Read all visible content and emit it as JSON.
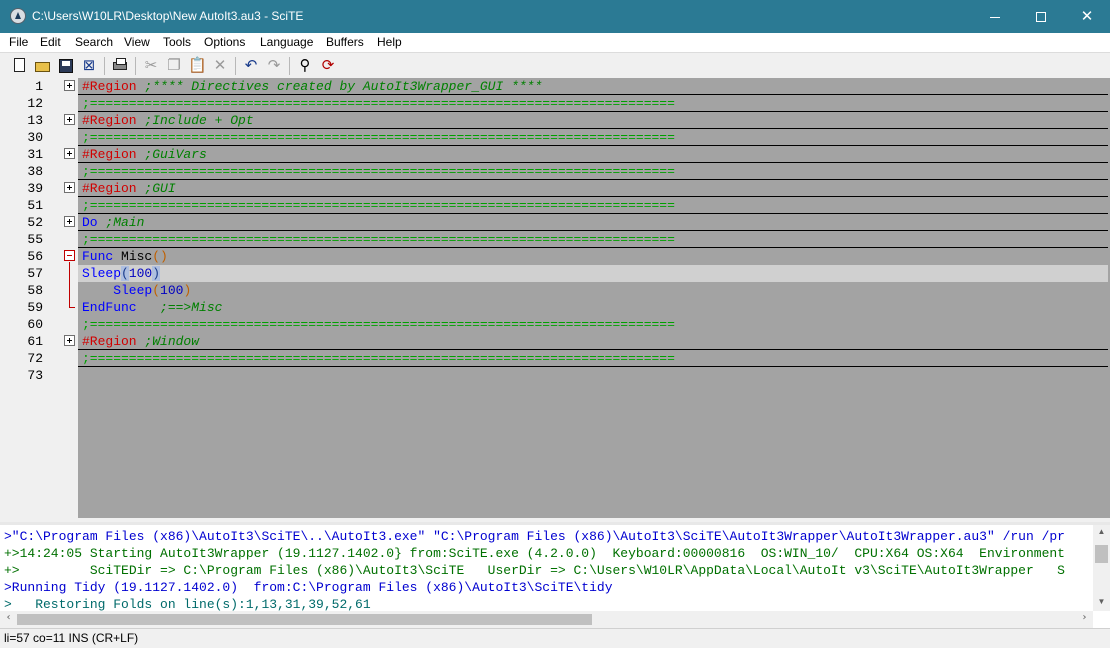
{
  "window": {
    "title": "C:\\Users\\W10LR\\Desktop\\New AutoIt3.au3 - SciTE",
    "app_icon": "scite-app-icon",
    "minimize_icon": "minimize-icon",
    "maximize_icon": "maximize-icon",
    "close_icon": "close-icon",
    "close_glyph": "✕"
  },
  "menu": [
    "File",
    "Edit",
    "Search",
    "View",
    "Tools",
    "Options",
    "Language",
    "Buffers",
    "Help"
  ],
  "toolbar": {
    "icons": [
      "new-file-icon",
      "open-folder-icon",
      "save-icon",
      "close-file-icon",
      "print-icon",
      "cut-icon",
      "copy-icon",
      "paste-icon",
      "delete-icon",
      "undo-icon",
      "redo-icon",
      "find-icon",
      "replace-icon"
    ],
    "glyphs": {
      "close": "⊠",
      "cut": "✂",
      "copy": "❐",
      "paste": "📋",
      "delete": "✕",
      "undo": "↶",
      "redo": "↷",
      "find": "⚲",
      "replace": "⟳"
    }
  },
  "editor": {
    "lines": [
      {
        "num": "1",
        "fold": "plus",
        "tokens": [
          {
            "t": "#Region",
            "c": "region"
          },
          {
            "t": " ;**** Directives created by AutoIt3Wrapper_GUI ****",
            "c": "comment"
          }
        ]
      },
      {
        "num": "12",
        "fold": "line",
        "tokens": [
          {
            "t": ";===========================================================================",
            "c": "sep"
          }
        ]
      },
      {
        "num": "13",
        "fold": "plus",
        "tokens": [
          {
            "t": "#Region",
            "c": "region"
          },
          {
            "t": " ;Include + Opt",
            "c": "comment"
          }
        ]
      },
      {
        "num": "30",
        "fold": "line",
        "tokens": [
          {
            "t": ";===========================================================================",
            "c": "sep"
          }
        ]
      },
      {
        "num": "31",
        "fold": "plus",
        "tokens": [
          {
            "t": "#Region",
            "c": "region"
          },
          {
            "t": " ;GuiVars",
            "c": "comment"
          }
        ]
      },
      {
        "num": "38",
        "fold": "line",
        "tokens": [
          {
            "t": ";===========================================================================",
            "c": "sep"
          }
        ]
      },
      {
        "num": "39",
        "fold": "plus",
        "tokens": [
          {
            "t": "#Region",
            "c": "region"
          },
          {
            "t": " ;GUI",
            "c": "comment"
          }
        ]
      },
      {
        "num": "51",
        "fold": "line",
        "tokens": [
          {
            "t": ";===========================================================================",
            "c": "sep"
          }
        ]
      },
      {
        "num": "52",
        "fold": "plus",
        "tokens": [
          {
            "t": "Do",
            "c": "kw"
          },
          {
            "t": " ;Main",
            "c": "comment"
          }
        ]
      },
      {
        "num": "55",
        "fold": "line",
        "tokens": [
          {
            "t": ";===========================================================================",
            "c": "sep"
          }
        ]
      },
      {
        "num": "56",
        "fold": "minus",
        "tokens": [
          {
            "t": "Func",
            "c": "kw"
          },
          {
            "t": " Misc",
            "c": "id"
          },
          {
            "t": "()",
            "c": "paren"
          }
        ]
      },
      {
        "num": "57",
        "fold": "vline",
        "caret": true,
        "tokens": [
          {
            "t": "Sleep",
            "c": "kw"
          },
          {
            "t": "(",
            "c": "paren-hl"
          },
          {
            "t": "100",
            "c": "num"
          },
          {
            "t": ")",
            "c": "paren-hl"
          }
        ]
      },
      {
        "num": "58",
        "fold": "vline",
        "tokens": [
          {
            "t": "    Sleep",
            "c": "kw"
          },
          {
            "t": "(",
            "c": "paren"
          },
          {
            "t": "100",
            "c": "num"
          },
          {
            "t": ")",
            "c": "paren"
          }
        ]
      },
      {
        "num": "59",
        "fold": "end",
        "tokens": [
          {
            "t": "EndFunc",
            "c": "kw"
          },
          {
            "t": "   ;==>Misc",
            "c": "comment"
          }
        ]
      },
      {
        "num": "60",
        "fold": "none",
        "tokens": [
          {
            "t": ";===========================================================================",
            "c": "sep"
          }
        ]
      },
      {
        "num": "61",
        "fold": "plus",
        "tokens": [
          {
            "t": "#Region",
            "c": "region"
          },
          {
            "t": " ;Window",
            "c": "comment"
          }
        ]
      },
      {
        "num": "72",
        "fold": "line",
        "tokens": [
          {
            "t": ";===========================================================================",
            "c": "sep"
          }
        ]
      },
      {
        "num": "73",
        "fold": "none",
        "tokens": []
      }
    ]
  },
  "output": {
    "lines": [
      {
        "c": "blue",
        "t": ">\"C:\\Program Files (x86)\\AutoIt3\\SciTE\\..\\AutoIt3.exe\" \"C:\\Program Files (x86)\\AutoIt3\\SciTE\\AutoIt3Wrapper\\AutoIt3Wrapper.au3\" /run /pr"
      },
      {
        "c": "green",
        "t": "+>14:24:05 Starting AutoIt3Wrapper (19.1127.1402.0} from:SciTE.exe (4.2.0.0)  Keyboard:00000816  OS:WIN_10/  CPU:X64 OS:X64  Environment"
      },
      {
        "c": "green",
        "t": "+>         SciTEDir => C:\\Program Files (x86)\\AutoIt3\\SciTE   UserDir => C:\\Users\\W10LR\\AppData\\Local\\AutoIt v3\\SciTE\\AutoIt3Wrapper   S"
      },
      {
        "c": "blue",
        "t": ">Running Tidy (19.1127.1402.0)  from:C:\\Program Files (x86)\\AutoIt3\\SciTE\\tidy"
      },
      {
        "c": "teal",
        "t": ">   Restoring Folds on line(s):1,13,31,39,52,61"
      }
    ],
    "scroll_left": "‹",
    "scroll_right": "›",
    "scroll_up": "▲",
    "scroll_down": "▼"
  },
  "status": {
    "text": "li=57 co=11 INS (CR+LF)"
  }
}
